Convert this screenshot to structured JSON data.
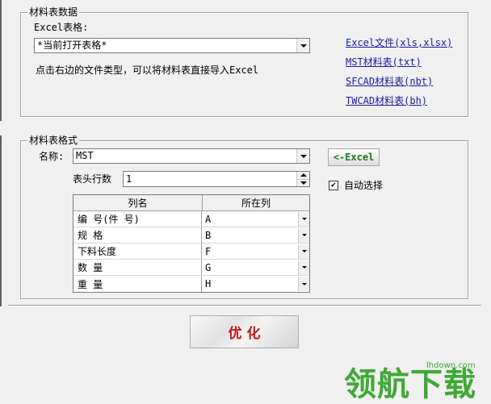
{
  "import_group": {
    "title": "材料表数据",
    "excel_label": "Excel表格:",
    "excel_value": "*当前打开表格*",
    "hint": "点击右边的文件类型，可以将材料表直接导入Excel",
    "links": [
      "Excel文件(xls,xlsx)",
      "MST材料表(txt)",
      "SFCAD材料表(nbt)",
      "TWCAD材料表(bh)"
    ]
  },
  "format_group": {
    "title": "材料表格式",
    "name_label": "名称:",
    "name_value": "MST",
    "excel_button": "<-Excel",
    "header_rows_label": "表头行数",
    "header_rows_value": "1",
    "auto_select_label": "自动选择",
    "auto_select_checked": true,
    "columns_header": [
      "列名",
      "所在列"
    ],
    "columns": [
      {
        "name": "编 号(件 号)",
        "col": "A"
      },
      {
        "name": "规 格",
        "col": "B"
      },
      {
        "name": "下料长度",
        "col": "F"
      },
      {
        "name": "数 量",
        "col": "G"
      },
      {
        "name": "重 量",
        "col": "H"
      }
    ]
  },
  "optimize_button": "优 化",
  "watermark": {
    "site": "lhdown.com",
    "brand": "领航下载"
  },
  "colors": {
    "link": "#1a1aa8",
    "excel_button_text": "#1e7a1e",
    "optimize_text": "#c01818",
    "watermark": "#3fa935"
  }
}
